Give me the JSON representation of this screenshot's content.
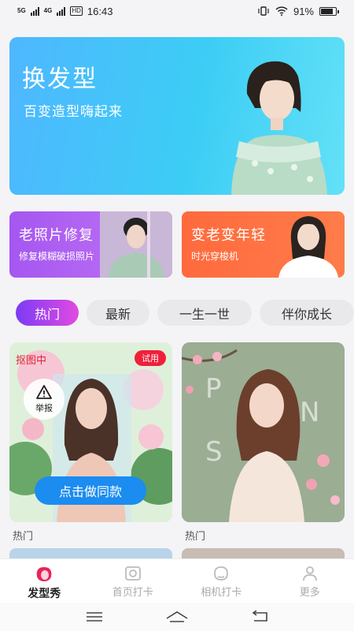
{
  "status": {
    "network1": "5G",
    "network2": "4G",
    "hd": "HD",
    "time": "16:43",
    "battery": "91%",
    "battery_level": 0.91
  },
  "hero": {
    "title": "换发型",
    "subtitle": "百变造型嗨起来"
  },
  "cards": [
    {
      "title": "老照片修复",
      "subtitle": "修复模糊破损照片"
    },
    {
      "title": "变老变年轻",
      "subtitle": "时光穿梭机"
    }
  ],
  "chips": [
    "热门",
    "最新",
    "一生一世",
    "伴你成长"
  ],
  "tiles": {
    "left": {
      "processing": "抠图中",
      "trial": "试用",
      "report": "举报",
      "button": "点击做同款",
      "label": "热门"
    },
    "right": {
      "label": "热门"
    }
  },
  "tabbar": [
    "发型秀",
    "首页打卡",
    "相机打卡",
    "更多"
  ],
  "colors": {
    "accent": "#e8235a",
    "hero": "#3ccdf5",
    "button": "#1b8cf0"
  }
}
